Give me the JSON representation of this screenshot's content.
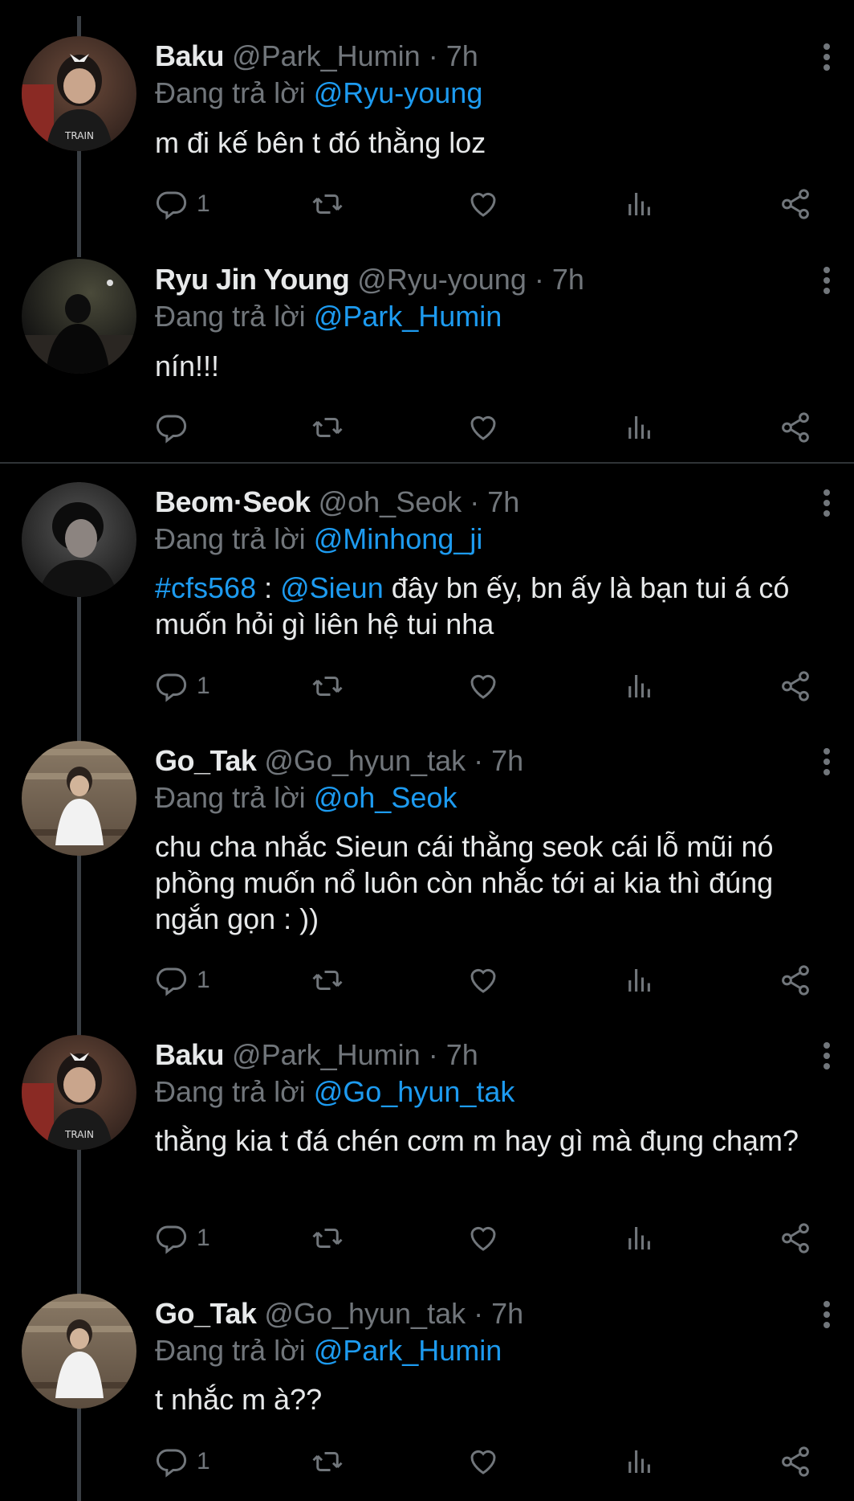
{
  "reply_prefix": "Đang trả lời",
  "tweets": [
    {
      "name": "Baku",
      "handle": "@Park_Humin",
      "time": "7h",
      "reply_to": "@Ryu-young",
      "text": "m đi kế bên t đó thằng loz",
      "reply_count": "1",
      "avatar": "avatar-baku"
    },
    {
      "name": "Ryu Jin Young",
      "handle": "@Ryu-young",
      "time": "7h",
      "reply_to": "@Park_Humin",
      "text": "nín!!!",
      "reply_count": "",
      "avatar": "avatar-ryu"
    },
    {
      "name": "Beom·Seok",
      "handle": "@oh_Seok",
      "time": "7h",
      "reply_to": "@Minhong_ji",
      "hashtag": "#cfs568",
      "separator": " : ",
      "mention": "@Sieun",
      "text": " đây bn ếy, bn ấy là bạn tui á có muốn hỏi gì liên hệ tui nha",
      "reply_count": "1",
      "avatar": "avatar-beom"
    },
    {
      "name": "Go_Tak",
      "handle": "@Go_hyun_tak",
      "time": "7h",
      "reply_to": "@oh_Seok",
      "text": "chu cha nhắc Sieun cái thằng seok cái lỗ mũi nó phồng muốn nổ luôn còn nhắc tới ai kia thì đúng ngắn gọn : ))",
      "reply_count": "1",
      "avatar": "avatar-gotak"
    },
    {
      "name": "Baku",
      "handle": "@Park_Humin",
      "time": "7h",
      "reply_to": "@Go_hyun_tak",
      "text": "thằng kia t đá chén cơm m hay gì mà đụng chạm?",
      "reply_count": "1",
      "avatar": "avatar-baku"
    },
    {
      "name": "Go_Tak",
      "handle": "@Go_hyun_tak",
      "time": "7h",
      "reply_to": "@Park_Humin",
      "text": "t nhắc m à??",
      "reply_count": "1",
      "avatar": "avatar-gotak"
    }
  ],
  "colors": {
    "background": "#000000",
    "text": "#e7e9ea",
    "secondary": "#71767b",
    "accent": "#1d9bf0",
    "thread_line": "#3a3f44"
  },
  "icons": [
    "reply-icon",
    "retweet-icon",
    "like-icon",
    "views-icon",
    "share-icon",
    "more-options-icon"
  ]
}
